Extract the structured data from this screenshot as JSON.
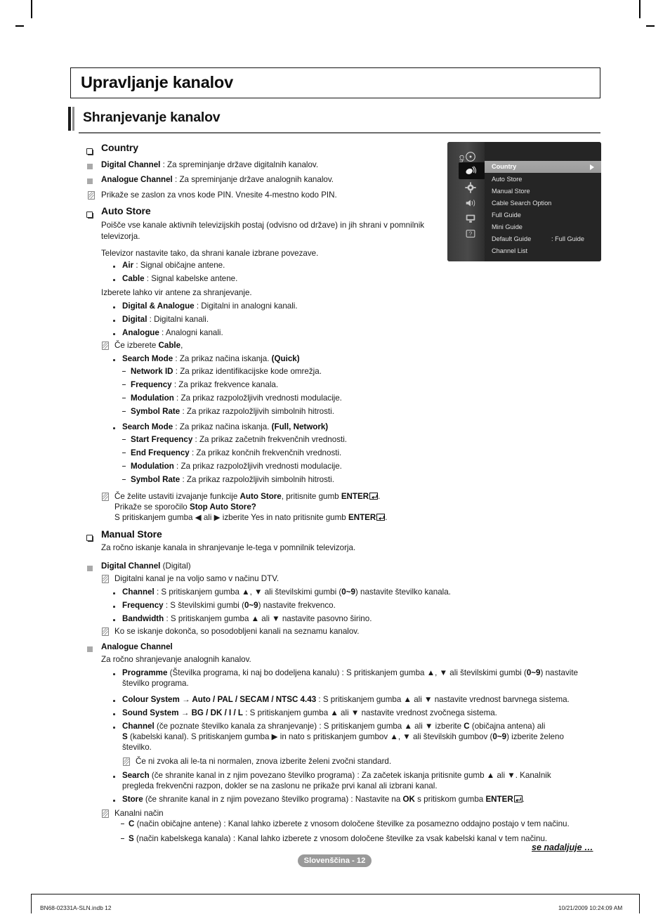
{
  "chapter": {
    "title": "Upravljanje kanalov"
  },
  "section": {
    "title": "Shranjevanje kanalov"
  },
  "blocks": {
    "country_heading": "Country",
    "digital_channel_label": "Digital Channel",
    "digital_channel_desc": " : Za spreminjanje države digitalnih kanalov.",
    "analogue_channel_label": "Analogue Channel",
    "analogue_channel_desc": " : Za spreminjanje države analognih kanalov.",
    "pin_note": "Prikaže se zaslon za vnos kode PIN. Vnesite 4-mestno kodo PIN.",
    "auto_store_heading": "Auto Store",
    "auto_store_desc": "Poišče vse kanale aktivnih televizijskih postaj (odvisno od države) in jih shrani v pomnilnik televizorja.",
    "auto_store_desc2": "Televizor nastavite tako, da shrani kanale izbrane povezave.",
    "air_label": "Air",
    "air_desc": " : Signal običajne antene.",
    "cable_label": "Cable",
    "cable_desc": " : Signal kabelske antene.",
    "source_line": "Izberete lahko vir antene za shranjevanje.",
    "dig_analog_label": "Digital & Analogue",
    "dig_analog_desc": " : Digitalni in analogni kanali.",
    "digital_label": "Digital",
    "digital_desc": " : Digitalni kanali.",
    "analogue_label": "Analogue",
    "analogue_desc": " : Analogni kanali.",
    "if_cable_pre": "Če izberete ",
    "if_cable_bold": "Cable",
    "if_cable_post": ",",
    "search_mode_label": "Search Mode",
    "search_mode_quick_desc": " : Za prikaz načina iskanja. ",
    "search_mode_quick_value": "(Quick)",
    "network_id_label": "Network ID",
    "network_id_desc": " : Za prikaz identifikacijske kode omrežja.",
    "frequency_label": "Frequency",
    "frequency_desc": " : Za prikaz frekvence kanala.",
    "modulation_label": "Modulation",
    "modulation_desc": " : Za prikaz razpoložljivih vrednosti modulacije.",
    "symbol_rate_label": "Symbol Rate",
    "symbol_rate_desc": " : Za prikaz razpoložljivih simbolnih hitrosti.",
    "search_mode_full_value": "(Full, Network)",
    "start_frequency_label": "Start Frequency",
    "start_frequency_desc": " : Za prikaz začetnih frekvenčnih vrednosti.",
    "end_frequency_label": "End Frequency",
    "end_frequency_desc": " : Za prikaz končnih frekvenčnih vrednosti.",
    "stop_note_1a": "Če želite ustaviti izvajanje funkcije ",
    "stop_note_1b": "Auto Store",
    "stop_note_1c": ", pritisnite gumb ",
    "stop_note_1d": "ENTER",
    "stop_note_2a": "Prikaže se sporočilo ",
    "stop_note_2b": "Stop Auto Store?",
    "stop_note_2c": ".",
    "stop_note_3a": "S pritiskanjem gumba ◀ ali ▶ izberite Yes in nato pritisnite gumb ",
    "stop_note_3b": "ENTER",
    "manual_store_heading": "Manual Store",
    "manual_store_desc": "Za ročno iskanje kanala in shranjevanje le-tega v pomnilnik televizorja.",
    "manual_digital_label": "Digital Channel",
    "manual_digital_suffix": " (Digital)",
    "dtv_note": "Digitalni kanal je na voljo samo v načinu DTV.",
    "m_channel_label": "Channel",
    "m_channel_desc_a": " : S pritiskanjem gumba ▲, ▼ ali številskimi gumbi (",
    "m_channel_desc_b": "0~9",
    "m_channel_desc_c": ") nastavite številko kanala.",
    "m_frequency_label": "Frequency",
    "m_frequency_desc_a": " : S številskimi gumbi (",
    "m_frequency_desc_b": "0~9",
    "m_frequency_desc_c": ") nastavite frekvenco.",
    "m_bandwidth_label": "Bandwidth",
    "m_bandwidth_desc": " : S pritiskanjem gumba ▲ ali ▼ nastavite pasovno širino.",
    "scan_done_note": "Ko se iskanje dokonča, so posodobljeni kanali na seznamu kanalov.",
    "manual_analogue_label": "Analogue Channel",
    "manual_analogue_desc": "Za ročno shranjevanje analognih kanalov.",
    "programme_label": "Programme",
    "programme_desc_a": " (Številka programa, ki naj bo dodeljena kanalu) : S pritiskanjem gumba ▲, ▼ ali številskimi gumbi (",
    "programme_desc_b": "0~9",
    "programme_desc_c": ") nastavite",
    "programme_desc_d": "številko programa.",
    "colour_system_label": "Colour System → Auto / PAL / SECAM / NTSC 4.43",
    "colour_system_desc": " : S pritiskanjem gumba ▲ ali ▼ nastavite vrednost barvnega sistema.",
    "sound_system_label": "Sound System → BG / DK / I / L",
    "sound_system_desc": " : S pritiskanjem gumba ▲ ali ▼ nastavite vrednost zvočnega sistema.",
    "a_channel_label": "Channel",
    "a_channel_desc_a": " (če poznate številko kanala za shranjevanje) :  S pritiskanjem gumba ▲ ali ▼ izberite ",
    "a_channel_bold_c": "C",
    "a_channel_desc_b": " (običajna antena) ali",
    "a_channel_bold_s": "S",
    "a_channel_desc_c": " (kabelski kanal). S pritiskanjem gumba ▶ in nato s pritiskanjem gumbov ▲, ▼ ali številskih gumbov (",
    "a_channel_bold_09": "0~9",
    "a_channel_desc_d": ") izberite želeno",
    "a_channel_desc_e": "številko.",
    "sound_note": "Če ni zvoka ali le-ta ni normalen, znova izberite želeni zvočni standard.",
    "search_label": "Search",
    "search_desc_a": " (če shranite kanal in z njim povezano številko programa) : Za začetek iskanja pritisnite gumb ▲ ali ▼. Kanalnik",
    "search_desc_b": "pregleda frekvenčni razpon, dokler se na zaslonu ne prikaže prvi kanal ali izbrani kanal.",
    "store_label": "Store",
    "store_desc_a": " (če shranite kanal in z njim povezano številko programa) : Nastavite na ",
    "store_bold_ok": "OK",
    "store_desc_b": " s pritiskom gumba ",
    "store_enter": "ENTER",
    "channel_mode_note": "Kanalni način",
    "mode_c_bold": "C",
    "mode_c_desc": " (način običajne antene) : Kanal lahko izberete z vnosom določene številke za posamezno oddajno postajo v tem načinu.",
    "mode_s_bold": "S",
    "mode_s_desc": " (način kabelskega kanala) : Kanal lahko izberete z vnosom določene številke za vsak kabelski kanal v tem načinu."
  },
  "osd": {
    "sidebar_label": "Channel",
    "items": [
      {
        "label": "Country",
        "value": "",
        "selected": true,
        "arrow": true
      },
      {
        "label": "Auto Store",
        "value": "",
        "selected": false,
        "arrow": false
      },
      {
        "label": "Manual Store",
        "value": "",
        "selected": false,
        "arrow": false
      },
      {
        "label": "Cable Search Option",
        "value": "",
        "selected": false,
        "arrow": false
      },
      {
        "label": "Full Guide",
        "value": "",
        "selected": false,
        "arrow": false
      },
      {
        "label": "Mini Guide",
        "value": "",
        "selected": false,
        "arrow": false
      },
      {
        "label": "Default Guide",
        "value": ": Full Guide",
        "selected": false,
        "arrow": false
      },
      {
        "label": "Channel List",
        "value": "",
        "selected": false,
        "arrow": false
      }
    ]
  },
  "footer": {
    "continued": "se nadaljuje …",
    "page_label": "Slovenščina - 12",
    "file_ref": "BN68-02331A-SLN.indb   12",
    "timestamp": "10/21/2009   10:24:09 AM"
  }
}
